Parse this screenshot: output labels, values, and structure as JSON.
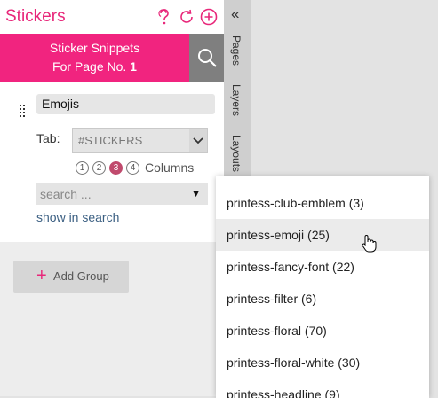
{
  "header": {
    "title": "Stickers"
  },
  "banner": {
    "line1": "Sticker Snippets",
    "line2_prefix": "For Page No.",
    "page_number": "1"
  },
  "group": {
    "name": "Emojis",
    "tab_label": "Tab:",
    "tab_value": "#STICKERS",
    "columns": [
      "1",
      "2",
      "3",
      "4"
    ],
    "selected_columns": "3",
    "columns_label": "Columns",
    "search_placeholder": "search ...",
    "show_in_search": "show in search"
  },
  "add_group": {
    "label": "Add Group"
  },
  "side_tabs": [
    "Pages",
    "Layers",
    "Layouts"
  ],
  "dropdown": {
    "items": [
      "printess-club-emblem (3)",
      "printess-emoji (25)",
      "printess-fancy-font (22)",
      "printess-filter (6)",
      "printess-floral (70)",
      "printess-floral-white (30)",
      "printess-headline (9)"
    ],
    "hovered_index": 1
  },
  "colors": {
    "accent": "#f1247f",
    "link": "#3b5f82",
    "active_column": "#c04a6d"
  },
  "icons": [
    "help-icon",
    "refresh-icon",
    "add-circle-icon",
    "search-icon",
    "drag-handle-icon",
    "chevron-down-icon",
    "collapse-left-icon",
    "hand-cursor-icon"
  ]
}
